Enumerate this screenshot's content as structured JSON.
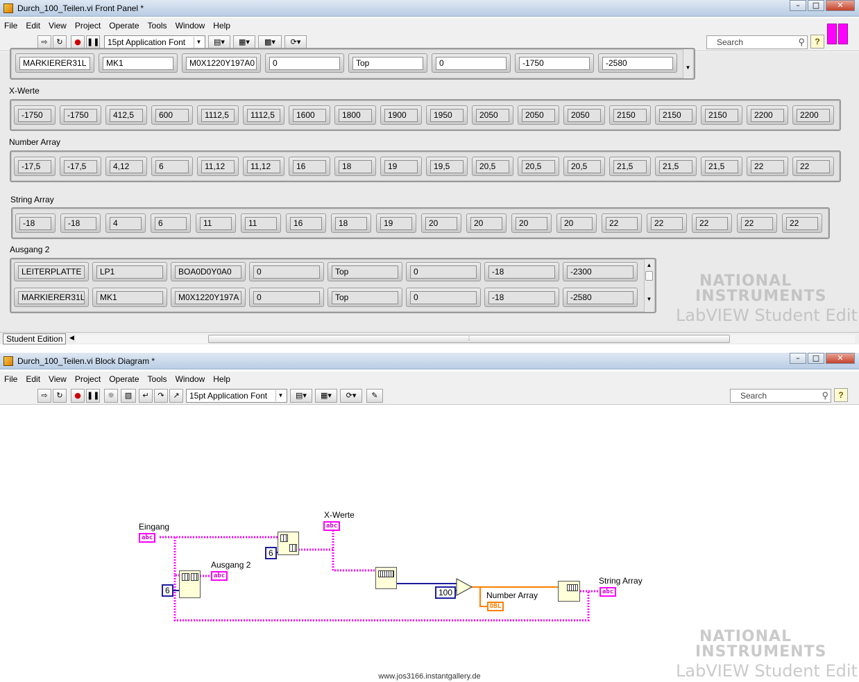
{
  "front_panel": {
    "title": "Durch_100_Teilen.vi Front Panel *",
    "menus": [
      "File",
      "Edit",
      "View",
      "Project",
      "Operate",
      "Tools",
      "Window",
      "Help"
    ],
    "font_selector": "15pt Application Font",
    "search_placeholder": "Search",
    "top_array": [
      "MARKIERER31L",
      "MK1",
      "M0X1220Y197A0",
      "0",
      "Top",
      "0",
      "-1750",
      "-2580"
    ],
    "x_werte": {
      "label": "X-Werte",
      "values": [
        "-1750",
        "-1750",
        "412,5",
        "600",
        "1112,5",
        "1112,5",
        "1600",
        "1800",
        "1900",
        "1950",
        "2050",
        "2050",
        "2050",
        "2150",
        "2150",
        "2150",
        "2200",
        "2200"
      ]
    },
    "number_array": {
      "label": "Number Array",
      "values": [
        "-17,5",
        "-17,5",
        "4,12",
        "6",
        "11,12",
        "11,12",
        "16",
        "18",
        "19",
        "19,5",
        "20,5",
        "20,5",
        "20,5",
        "21,5",
        "21,5",
        "21,5",
        "22",
        "22"
      ]
    },
    "string_array": {
      "label": "String Array",
      "values": [
        "-18",
        "-18",
        "4",
        "6",
        "11",
        "11",
        "16",
        "18",
        "19",
        "20",
        "20",
        "20",
        "20",
        "22",
        "22",
        "22",
        "22",
        "22"
      ]
    },
    "ausgang2": {
      "label": "Ausgang 2",
      "rows": [
        [
          "LEITERPLATTE",
          "LP1",
          "BOA0D0Y0A0",
          "0",
          "Top",
          "0",
          "-18",
          "-2300"
        ],
        [
          "MARKIERER31L",
          "MK1",
          "M0X1220Y197A",
          "0",
          "Top",
          "0",
          "-18",
          "-2580"
        ]
      ]
    },
    "status": "Student Edition"
  },
  "watermark": {
    "line1": "NATIONAL",
    "line2": "INSTRUMENTS",
    "line3": "LabVIEW Student Edition"
  },
  "block_diagram": {
    "title": "Durch_100_Teilen.vi Block Diagram *",
    "menus": [
      "File",
      "Edit",
      "View",
      "Project",
      "Operate",
      "Tools",
      "Window",
      "Help"
    ],
    "font_selector": "15pt Application Font",
    "search_placeholder": "Search",
    "labels": {
      "eingang": "Eingang",
      "x_werte": "X-Werte",
      "ausgang2": "Ausgang 2",
      "number_array": "Number Array",
      "string_array": "String Array"
    },
    "constants": {
      "c6a": "6",
      "c6b": "6",
      "c100": "100"
    },
    "terminal_abc": "abc",
    "terminal_dbl": "DBL"
  },
  "footer_url": "www.jos3166.instantgallery.de",
  "colors": {
    "string_wire": "#ff00ff",
    "dbl_wire": "#ff7f00",
    "int_wire": "#1c1c9c"
  }
}
